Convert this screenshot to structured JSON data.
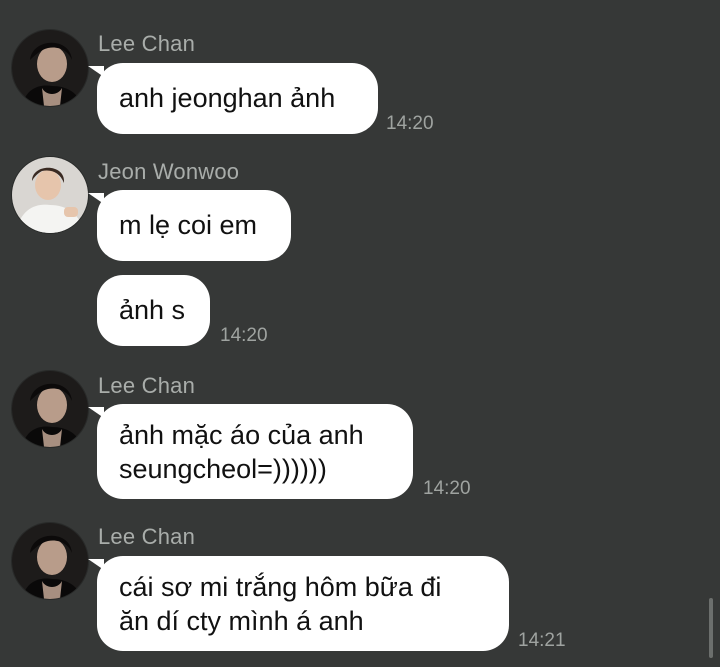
{
  "colors": {
    "background": "#363837",
    "bubble": "#ffffff",
    "sender_name": "#a9adaa",
    "timestamp": "#9fa3a0",
    "message_text": "#111111"
  },
  "messages": [
    {
      "sender": "Lee Chan",
      "avatar_icon": "user-avatar-lee-chan",
      "text": "anh jeonghan ảnh",
      "time": "14:20"
    },
    {
      "sender": "Jeon Wonwoo",
      "avatar_icon": "user-avatar-jeon-wonwoo",
      "text": "m lẹ coi em",
      "time": ""
    },
    {
      "sender": "",
      "avatar_icon": "",
      "text": "ảnh s",
      "time": "14:20"
    },
    {
      "sender": "Lee Chan",
      "avatar_icon": "user-avatar-lee-chan",
      "text": "ảnh mặc áo của anh\nseungcheol=))))))",
      "time": "14:20"
    },
    {
      "sender": "Lee Chan",
      "avatar_icon": "user-avatar-lee-chan",
      "text": "cái sơ mi trắng hôm bữa đi\năn dí cty mình á anh",
      "time": "14:21"
    }
  ]
}
